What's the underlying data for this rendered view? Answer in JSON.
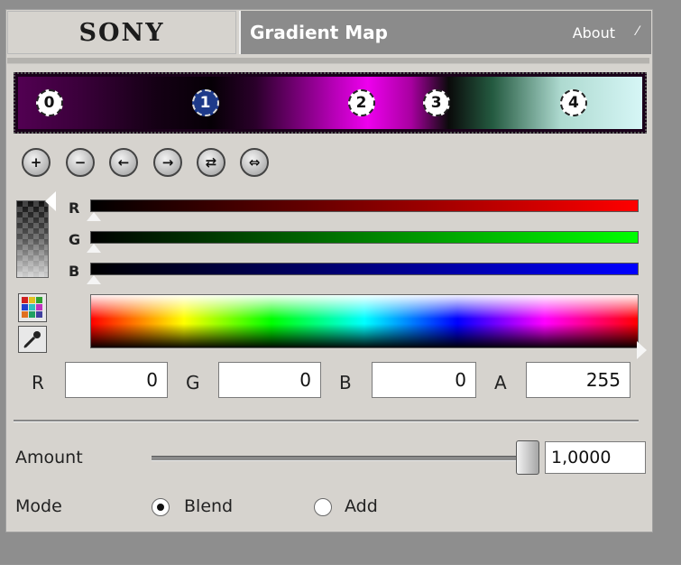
{
  "header": {
    "logo_text": "SONY",
    "title": "Gradient Map",
    "about_label": "About",
    "about_caret": "⁄"
  },
  "gradient": {
    "stops": [
      {
        "label": "0",
        "position": 0.05,
        "selected": false
      },
      {
        "label": "1",
        "position": 0.3,
        "selected": true
      },
      {
        "label": "2",
        "position": 0.55,
        "selected": false
      },
      {
        "label": "3",
        "position": 0.67,
        "selected": false
      },
      {
        "label": "4",
        "position": 0.89,
        "selected": false
      }
    ]
  },
  "toolbar": {
    "add_stop_icon": "+",
    "remove_stop_icon": "−",
    "move_left_icon": "←",
    "move_right_icon": "→",
    "swap_icon": "⇄",
    "distribute_icon": "⇔"
  },
  "channels": [
    {
      "label": "R",
      "value": 0,
      "color": "#ff0000"
    },
    {
      "label": "G",
      "value": 0,
      "color": "#00ff00"
    },
    {
      "label": "B",
      "value": 0,
      "color": "#0000ff"
    }
  ],
  "inputs": {
    "r_label": "R",
    "r_value": "0",
    "g_label": "G",
    "g_value": "0",
    "b_label": "B",
    "b_value": "0",
    "a_label": "A",
    "a_value": "255"
  },
  "amount": {
    "label": "Amount",
    "value": "1,0000",
    "level": 1.0
  },
  "mode": {
    "label": "Mode",
    "options": [
      {
        "label": "Blend",
        "selected": true
      },
      {
        "label": "Add",
        "selected": false
      }
    ]
  }
}
